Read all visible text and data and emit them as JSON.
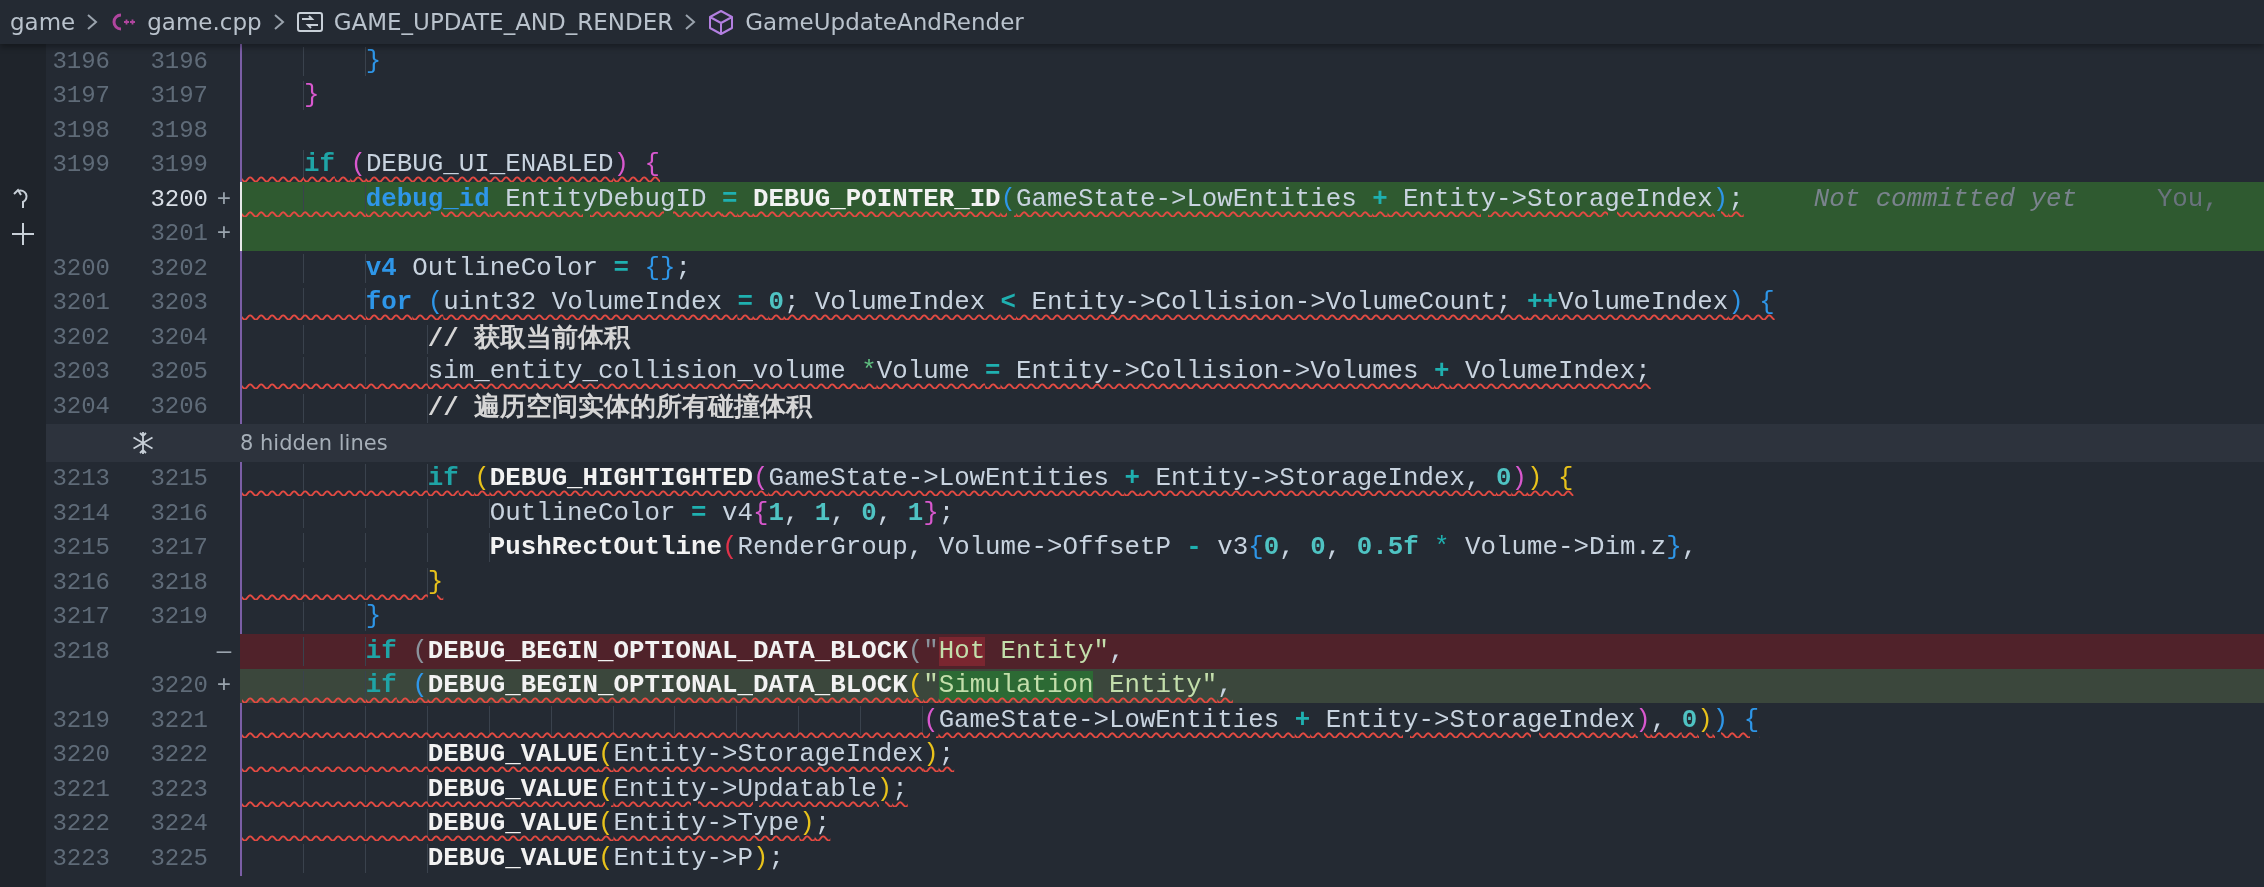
{
  "breadcrumb": [
    {
      "text": "game",
      "kind": "folder"
    },
    {
      "text": "game.cpp",
      "kind": "cpp-file"
    },
    {
      "text": "GAME_UPDATE_AND_RENDER",
      "kind": "macro"
    },
    {
      "text": "GameUpdateAndRender",
      "kind": "function"
    }
  ],
  "lines": [
    {
      "kind": "context",
      "old": "3196",
      "new": "3196",
      "squiggle": false,
      "tokens": [
        {
          "text": "        }",
          "color": "#2e96e8"
        }
      ]
    },
    {
      "kind": "context",
      "old": "3197",
      "new": "3197",
      "squiggle": false,
      "tokens": [
        {
          "text": "    }",
          "color": "#d958cf"
        }
      ]
    },
    {
      "kind": "context",
      "old": "3198",
      "new": "3198"
    },
    {
      "kind": "context",
      "old": "3199",
      "new": "3199",
      "squiggle": true,
      "tokens": [
        {
          "text": "    **if** ",
          "color": "#1fa4a6"
        },
        {
          "text": "(",
          "color": "#d958cf"
        },
        {
          "text": "DEBUG_UI_ENABLED",
          "color": "#c8d3df"
        },
        {
          "text": ") {",
          "color": "#d958cf"
        }
      ]
    },
    {
      "kind": "added",
      "new": "3200",
      "marker": "+",
      "current": true,
      "gutter": {
        "kind": "revert"
      },
      "squiggle": true,
      "tokens": [
        {
          "text": "        **debug_id**",
          "color": "#2e96e8"
        },
        {
          "text": " EntityDebugID ",
          "color": "#c8d3df"
        },
        {
          "text": "**=**",
          "color": "#1fb0b0"
        },
        {
          "text": " **DEBUG_POINTER_ID**",
          "color": "#f2f2f2"
        },
        {
          "text": "(",
          "color": "#2e96e8"
        },
        {
          "text": "GameState->LowEntities ",
          "color": "#c8d3df"
        },
        {
          "text": "**+**",
          "color": "#1fb0b0"
        },
        {
          "text": " Entity->StorageIndex",
          "color": "#c8d3df"
        },
        {
          "text": ")",
          "color": "#2e96e8"
        },
        {
          "text": ";",
          "color": "#c8d3df"
        }
      ],
      "blame": {
        "message": "Not committed yet",
        "author": "You,"
      }
    },
    {
      "kind": "added",
      "new": "3201",
      "marker": "+",
      "gutter": {
        "kind": "add"
      }
    },
    {
      "kind": "context",
      "old": "3200",
      "new": "3202",
      "squiggle": false,
      "tokens": [
        {
          "text": "        **v4**",
          "color": "#2e96e8"
        },
        {
          "text": " OutlineColor ",
          "color": "#c8d3df"
        },
        {
          "text": "**=**",
          "color": "#1fb0b0"
        },
        {
          "text": " {}",
          "color": "#2e96e8"
        },
        {
          "text": ";",
          "color": "#c8d3df"
        }
      ]
    },
    {
      "kind": "context",
      "old": "3201",
      "new": "3203",
      "squiggle": true,
      "tokens": [
        {
          "text": "        **for** (",
          "color": "#2e96e8"
        },
        {
          "text": "uint32 VolumeIndex ",
          "color": "#c8d3df"
        },
        {
          "text": "**=**",
          "color": "#1fb0b0"
        },
        {
          "text": " **0**",
          "color": "#4fc3c3"
        },
        {
          "text": "; VolumeIndex ",
          "color": "#c8d3df"
        },
        {
          "text": "**<**",
          "color": "#1fb0b0"
        },
        {
          "text": " Entity->Collision->VolumeCount; ",
          "color": "#c8d3df"
        },
        {
          "text": "**++**",
          "color": "#1fb0b0"
        },
        {
          "text": "VolumeIndex",
          "color": "#c8d3df"
        },
        {
          "text": ") {",
          "color": "#2e96e8"
        }
      ]
    },
    {
      "kind": "context",
      "old": "3202",
      "new": "3204",
      "squiggle": false,
      "tokens": [
        {
          "text": "            **// 获取当前体积**",
          "color": "#d6d6d6"
        }
      ]
    },
    {
      "kind": "context",
      "old": "3203",
      "new": "3205",
      "squiggle": true,
      "tokens": [
        {
          "text": "            sim_entity_collision_volume ",
          "color": "#c8d3df"
        },
        {
          "text": "*",
          "color": "#5fbf80"
        },
        {
          "text": "Volume ",
          "color": "#c8d3df"
        },
        {
          "text": "**=**",
          "color": "#1fb0b0"
        },
        {
          "text": " Entity->Collision->Volumes ",
          "color": "#c8d3df"
        },
        {
          "text": "**+**",
          "color": "#1fb0b0"
        },
        {
          "text": " VolumeIndex;",
          "color": "#c8d3df"
        }
      ]
    },
    {
      "kind": "context",
      "old": "3204",
      "new": "3206",
      "squiggle": false,
      "tokens": [
        {
          "text": "            **// 遍历空间实体的所有碰撞体积**",
          "color": "#d6d6d6"
        }
      ]
    },
    {
      "kind": "hidden",
      "text": "8 hidden lines"
    },
    {
      "kind": "context",
      "old": "3213",
      "new": "3215",
      "squiggle": true,
      "tokens": [
        {
          "text": "            **if** ",
          "color": "#1fa4a6"
        },
        {
          "text": "(",
          "color": "#e8c21b"
        },
        {
          "text": "**DEBUG_HIGHTIGHTED**",
          "color": "#f2f2f2"
        },
        {
          "text": "(",
          "color": "#d958cf"
        },
        {
          "text": "GameState->LowEntities ",
          "color": "#c8d3df"
        },
        {
          "text": "**+**",
          "color": "#1fb0b0"
        },
        {
          "text": " Entity->StorageIndex, ",
          "color": "#c8d3df"
        },
        {
          "text": "**0**",
          "color": "#4fc3c3"
        },
        {
          "text": ")",
          "color": "#d958cf"
        },
        {
          "text": ") {",
          "color": "#e8c21b"
        }
      ]
    },
    {
      "kind": "context",
      "old": "3214",
      "new": "3216",
      "squiggle": false,
      "tokens": [
        {
          "text": "                OutlineColor ",
          "color": "#c8d3df"
        },
        {
          "text": "**=**",
          "color": "#1fb0b0"
        },
        {
          "text": " v4",
          "color": "#c8d3df"
        },
        {
          "text": "{",
          "color": "#d958cf"
        },
        {
          "text": "**1**",
          "color": "#4fc3c3"
        },
        {
          "text": ", ",
          "color": "#c8d3df"
        },
        {
          "text": "**1**",
          "color": "#4fc3c3"
        },
        {
          "text": ", ",
          "color": "#c8d3df"
        },
        {
          "text": "**0**",
          "color": "#4fc3c3"
        },
        {
          "text": ", ",
          "color": "#c8d3df"
        },
        {
          "text": "**1**",
          "color": "#4fc3c3"
        },
        {
          "text": "}",
          "color": "#d958cf"
        },
        {
          "text": ";",
          "color": "#c8d3df"
        }
      ]
    },
    {
      "kind": "context",
      "old": "3215",
      "new": "3217",
      "squiggle": false,
      "tokens": [
        {
          "text": "                **PushRectOutline**",
          "color": "#f2f2f2"
        },
        {
          "text": "(",
          "color": "#e0324a"
        },
        {
          "text": "RenderGroup, Volume->OffsetP ",
          "color": "#c8d3df"
        },
        {
          "text": "**-**",
          "color": "#1fb0b0"
        },
        {
          "text": " v3",
          "color": "#c8d3df"
        },
        {
          "text": "{",
          "color": "#2e96e8"
        },
        {
          "text": "**0**",
          "color": "#4fc3c3"
        },
        {
          "text": ", ",
          "color": "#c8d3df"
        },
        {
          "text": "**0**",
          "color": "#4fc3c3"
        },
        {
          "text": ", ",
          "color": "#c8d3df"
        },
        {
          "text": "**0.5f**",
          "color": "#4fc3c3"
        },
        {
          "text": " *",
          "color": "#1fb0b0"
        },
        {
          "text": " Volume->Dim.z",
          "color": "#c8d3df"
        },
        {
          "text": "}",
          "color": "#2e96e8"
        },
        {
          "text": ",",
          "color": "#c8d3df"
        }
      ]
    },
    {
      "kind": "context",
      "old": "3216",
      "new": "3218",
      "squiggle": true,
      "tokens": [
        {
          "text": "            }",
          "color": "#e8c21b"
        }
      ]
    },
    {
      "kind": "context",
      "old": "3217",
      "new": "3219",
      "squiggle": false,
      "tokens": [
        {
          "text": "        }",
          "color": "#2e96e8"
        }
      ]
    },
    {
      "kind": "removed",
      "old": "3218",
      "marker": "—",
      "squiggle": false,
      "tokens": [
        {
          "text": "        **if** ",
          "color": "#1fa4a6",
          "changed": false
        },
        {
          "text": "(",
          "color": "#8a939c",
          "changed": false
        },
        {
          "text": "**DEBUG_BEGIN_OPTIONAL_DATA_BLOCK**",
          "color": "#f2f2f2",
          "changed": false
        },
        {
          "text": "(\"",
          "color": "#8a939c",
          "changed": false
        },
        {
          "text": "Hot",
          "changed": true
        },
        {
          "text": " Entity\"",
          "color": "#c3deab",
          "changed": false
        },
        {
          "text": ",",
          "color": "#c8d3df",
          "changed": false
        }
      ]
    },
    {
      "kind": "changed",
      "new": "3220",
      "marker": "+",
      "squiggle": true,
      "tokens": [
        {
          "text": "        **if** ",
          "color": "#1fa4a6",
          "changed": false
        },
        {
          "text": "(",
          "color": "#2e96e8",
          "changed": false
        },
        {
          "text": "**DEBUG_BEGIN_OPTIONAL_DATA_BLOCK**",
          "color": "#f2f2f2",
          "changed": false
        },
        {
          "text": "(",
          "color": "#e8c21b",
          "changed": false
        },
        {
          "text": "\"",
          "color": "#c3deab",
          "changed": false
        },
        {
          "text": "Simulation",
          "changed": true
        },
        {
          "text": " Entity\"",
          "color": "#c3deab",
          "changed": false
        },
        {
          "text": ",",
          "color": "#c8d3df",
          "changed": false
        }
      ]
    },
    {
      "kind": "context",
      "old": "3219",
      "new": "3221",
      "squiggle": true,
      "tokens": [
        {
          "text": "                                            (",
          "color": "#d958cf"
        },
        {
          "text": "GameState->LowEntities ",
          "color": "#c8d3df"
        },
        {
          "text": "**+**",
          "color": "#1fb0b0"
        },
        {
          "text": " Entity->StorageIndex",
          "color": "#c8d3df"
        },
        {
          "text": ")",
          "color": "#d958cf"
        },
        {
          "text": ", ",
          "color": "#c8d3df"
        },
        {
          "text": "**0**",
          "color": "#4fc3c3"
        },
        {
          "text": ")",
          "color": "#e8c21b"
        },
        {
          "text": ") {",
          "color": "#2e96e8"
        }
      ]
    },
    {
      "kind": "context",
      "old": "3220",
      "new": "3222",
      "squiggle": true,
      "tokens": [
        {
          "text": "            **DEBUG_VALUE**",
          "color": "#f2f2f2"
        },
        {
          "text": "(",
          "color": "#e8c21b"
        },
        {
          "text": "Entity->StorageIndex",
          "color": "#c8d3df"
        },
        {
          "text": ")",
          "color": "#e8c21b"
        },
        {
          "text": ";",
          "color": "#c8d3df"
        }
      ]
    },
    {
      "kind": "context",
      "old": "3221",
      "new": "3223",
      "squiggle": true,
      "tokens": [
        {
          "text": "            **DEBUG_VALUE**",
          "color": "#f2f2f2"
        },
        {
          "text": "(",
          "color": "#e8c21b"
        },
        {
          "text": "Entity->Updatable",
          "color": "#c8d3df"
        },
        {
          "text": ")",
          "color": "#e8c21b"
        },
        {
          "text": ";",
          "color": "#c8d3df"
        }
      ]
    },
    {
      "kind": "context",
      "old": "3222",
      "new": "3224",
      "squiggle": true,
      "tokens": [
        {
          "text": "            **DEBUG_VALUE**",
          "color": "#f2f2f2"
        },
        {
          "text": "(",
          "color": "#e8c21b"
        },
        {
          "text": "Entity->Type",
          "color": "#c8d3df"
        },
        {
          "text": ")",
          "color": "#e8c21b"
        },
        {
          "text": ";",
          "color": "#c8d3df"
        }
      ]
    },
    {
      "kind": "context",
      "old": "3223",
      "new": "3225",
      "squiggle": false,
      "tokens": [
        {
          "text": "            **DEBUG_VALUE**",
          "color": "#f2f2f2"
        },
        {
          "text": "(",
          "color": "#e8c21b"
        },
        {
          "text": "Entity->P",
          "color": "#c8d3df"
        },
        {
          "text": ")",
          "color": "#e8c21b"
        },
        {
          "text": ";",
          "color": "#c8d3df"
        }
      ]
    }
  ]
}
